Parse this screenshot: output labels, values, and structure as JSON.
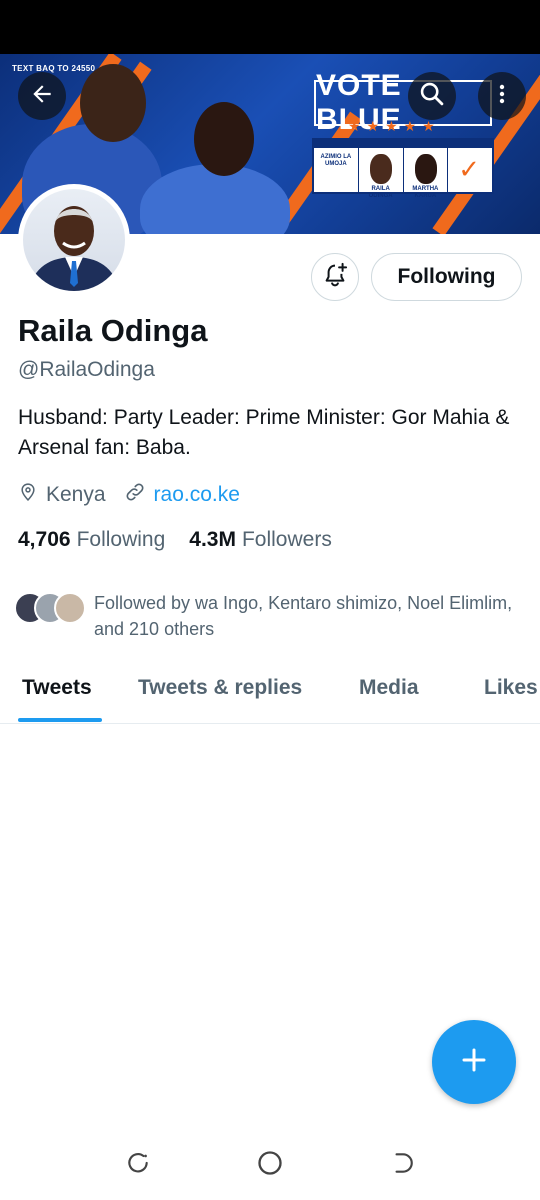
{
  "banner": {
    "small_text": "TEXT BAQ TO 24550",
    "vote_text": "VOTE BLUE",
    "stars": "★★★★★",
    "ballot_party": "AZIMIO LA UMOJA",
    "ballot_candidate": "RAILA ODINGA",
    "ballot_deputy": "MARTHA KARUA"
  },
  "header": {
    "back_icon": "arrow-left-icon",
    "search_icon": "search-icon",
    "more_icon": "more-vertical-icon"
  },
  "profile": {
    "name": "Raila Odinga",
    "handle": "@RailaOdinga",
    "bio": "Husband: Party Leader: Prime Minister: Gor Mahia & Arsenal fan: Baba.",
    "location": "Kenya",
    "website": "rao.co.ke",
    "following_count": "4,706",
    "following_label": "Following",
    "followers_count": "4.3M",
    "followers_label": "Followers",
    "followed_by": "Followed by wa Ingo, Kentaro shimizo, Noel Elimlim, and 210 others"
  },
  "actions": {
    "notify_icon": "bell-plus-icon",
    "following_button": "Following"
  },
  "tabs": [
    {
      "label": "Tweets",
      "active": true
    },
    {
      "label": "Tweets & replies",
      "active": false
    },
    {
      "label": "Media",
      "active": false
    },
    {
      "label": "Likes",
      "active": false
    }
  ],
  "fab": {
    "icon": "plus-icon"
  },
  "navbar": {
    "recents_icon": "recents-icon",
    "home_icon": "home-circle-icon",
    "back_icon": "nav-back-icon"
  },
  "colors": {
    "accent": "#1d9bf0",
    "text": "#0f1419",
    "muted": "#536471",
    "banner_blue": "#1a4fb5",
    "banner_orange": "#f06a1d"
  }
}
